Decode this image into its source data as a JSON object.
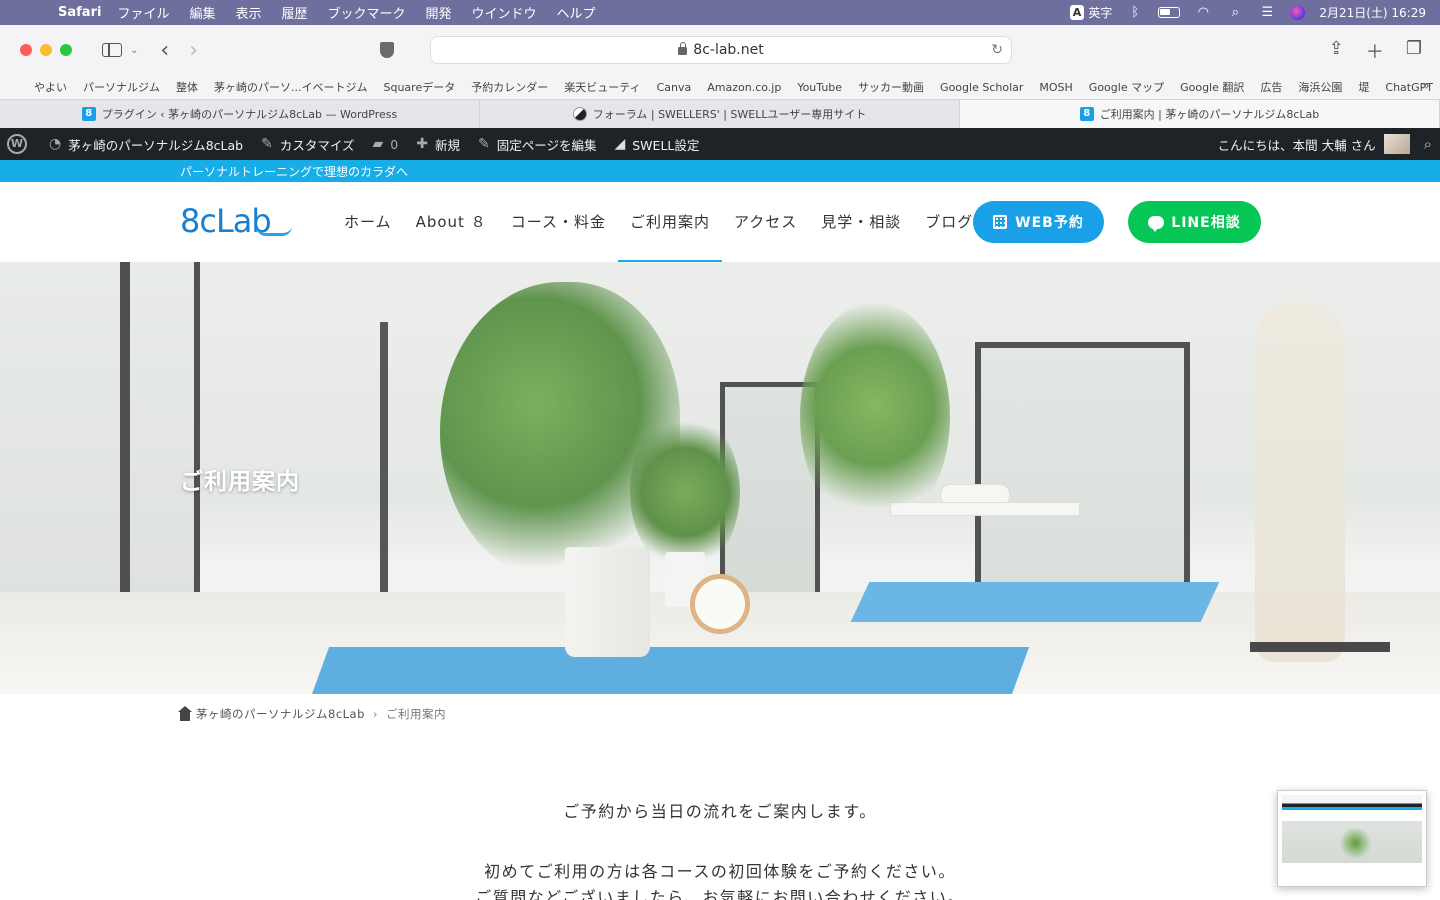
{
  "menubar": {
    "app_name": "Safari",
    "menus": [
      "ファイル",
      "編集",
      "表示",
      "履歴",
      "ブックマーク",
      "開発",
      "ウインドウ",
      "ヘルプ"
    ],
    "ime_glyph": "A",
    "ime_label": "英字",
    "datetime": "2月21日(土)  16:29"
  },
  "toolbar": {
    "url": "8c-lab.net"
  },
  "favorites": [
    "やよい",
    "パーソナルジム",
    "整体",
    "茅ヶ崎のパーソ...イベートジム",
    "Squareデータ",
    "予約カレンダー",
    "楽天ビューティ",
    "Canva",
    "Amazon.co.jp",
    "YouTube",
    "サッカー動画",
    "Google Scholar",
    "MOSH",
    "Google マップ",
    "Google 翻訳",
    "広告",
    "海浜公園",
    "堤",
    "ChatGPT"
  ],
  "tabs": [
    {
      "title": "プラグイン ‹ 茅ヶ崎のパーソナルジム8cLab — WordPress",
      "favicon": "8",
      "active": false
    },
    {
      "title": "フォーラム | SWELLERS' | SWELLユーザー専用サイト",
      "favicon": "swell",
      "active": false
    },
    {
      "title": "ご利用案内 | 茅ヶ崎のパーソナルジム8cLab",
      "favicon": "8",
      "active": true
    }
  ],
  "adminbar": {
    "site_name": "茅ヶ崎のパーソナルジム8cLab",
    "customize": "カスタマイズ",
    "comments_count": "0",
    "new": "新規",
    "edit_page": "固定ページを編集",
    "swell_settings": "SWELL設定",
    "greeting": "こんにちは、本間 大輔 さん"
  },
  "site": {
    "tagline": "パーソナルトレーニングで理想のカラダへ",
    "logo_text": "8cLab",
    "nav": [
      "ホーム",
      "About ８",
      "コース・料金",
      "ご利用案内",
      "アクセス",
      "見学・相談",
      "ブログ"
    ],
    "nav_current_index": 3,
    "web_button": "WEB予約",
    "line_button": "LINE相談",
    "colors": {
      "accent": "#17aee7",
      "web_button": "#1aa0e6",
      "line_button": "#06c755",
      "adminbar": "#1d2327"
    }
  },
  "hero": {
    "title": "ご利用案内"
  },
  "breadcrumb": {
    "home": "茅ヶ崎のパーソナルジム8cLab",
    "current": "ご利用案内"
  },
  "content": {
    "p1": "ご予約から当日の流れをご案内します。",
    "p2": "初めてご利用の方は各コースの初回体験をご予約ください。",
    "p3": "ご質問などございましたら、お気軽にお問い合わせください。"
  }
}
